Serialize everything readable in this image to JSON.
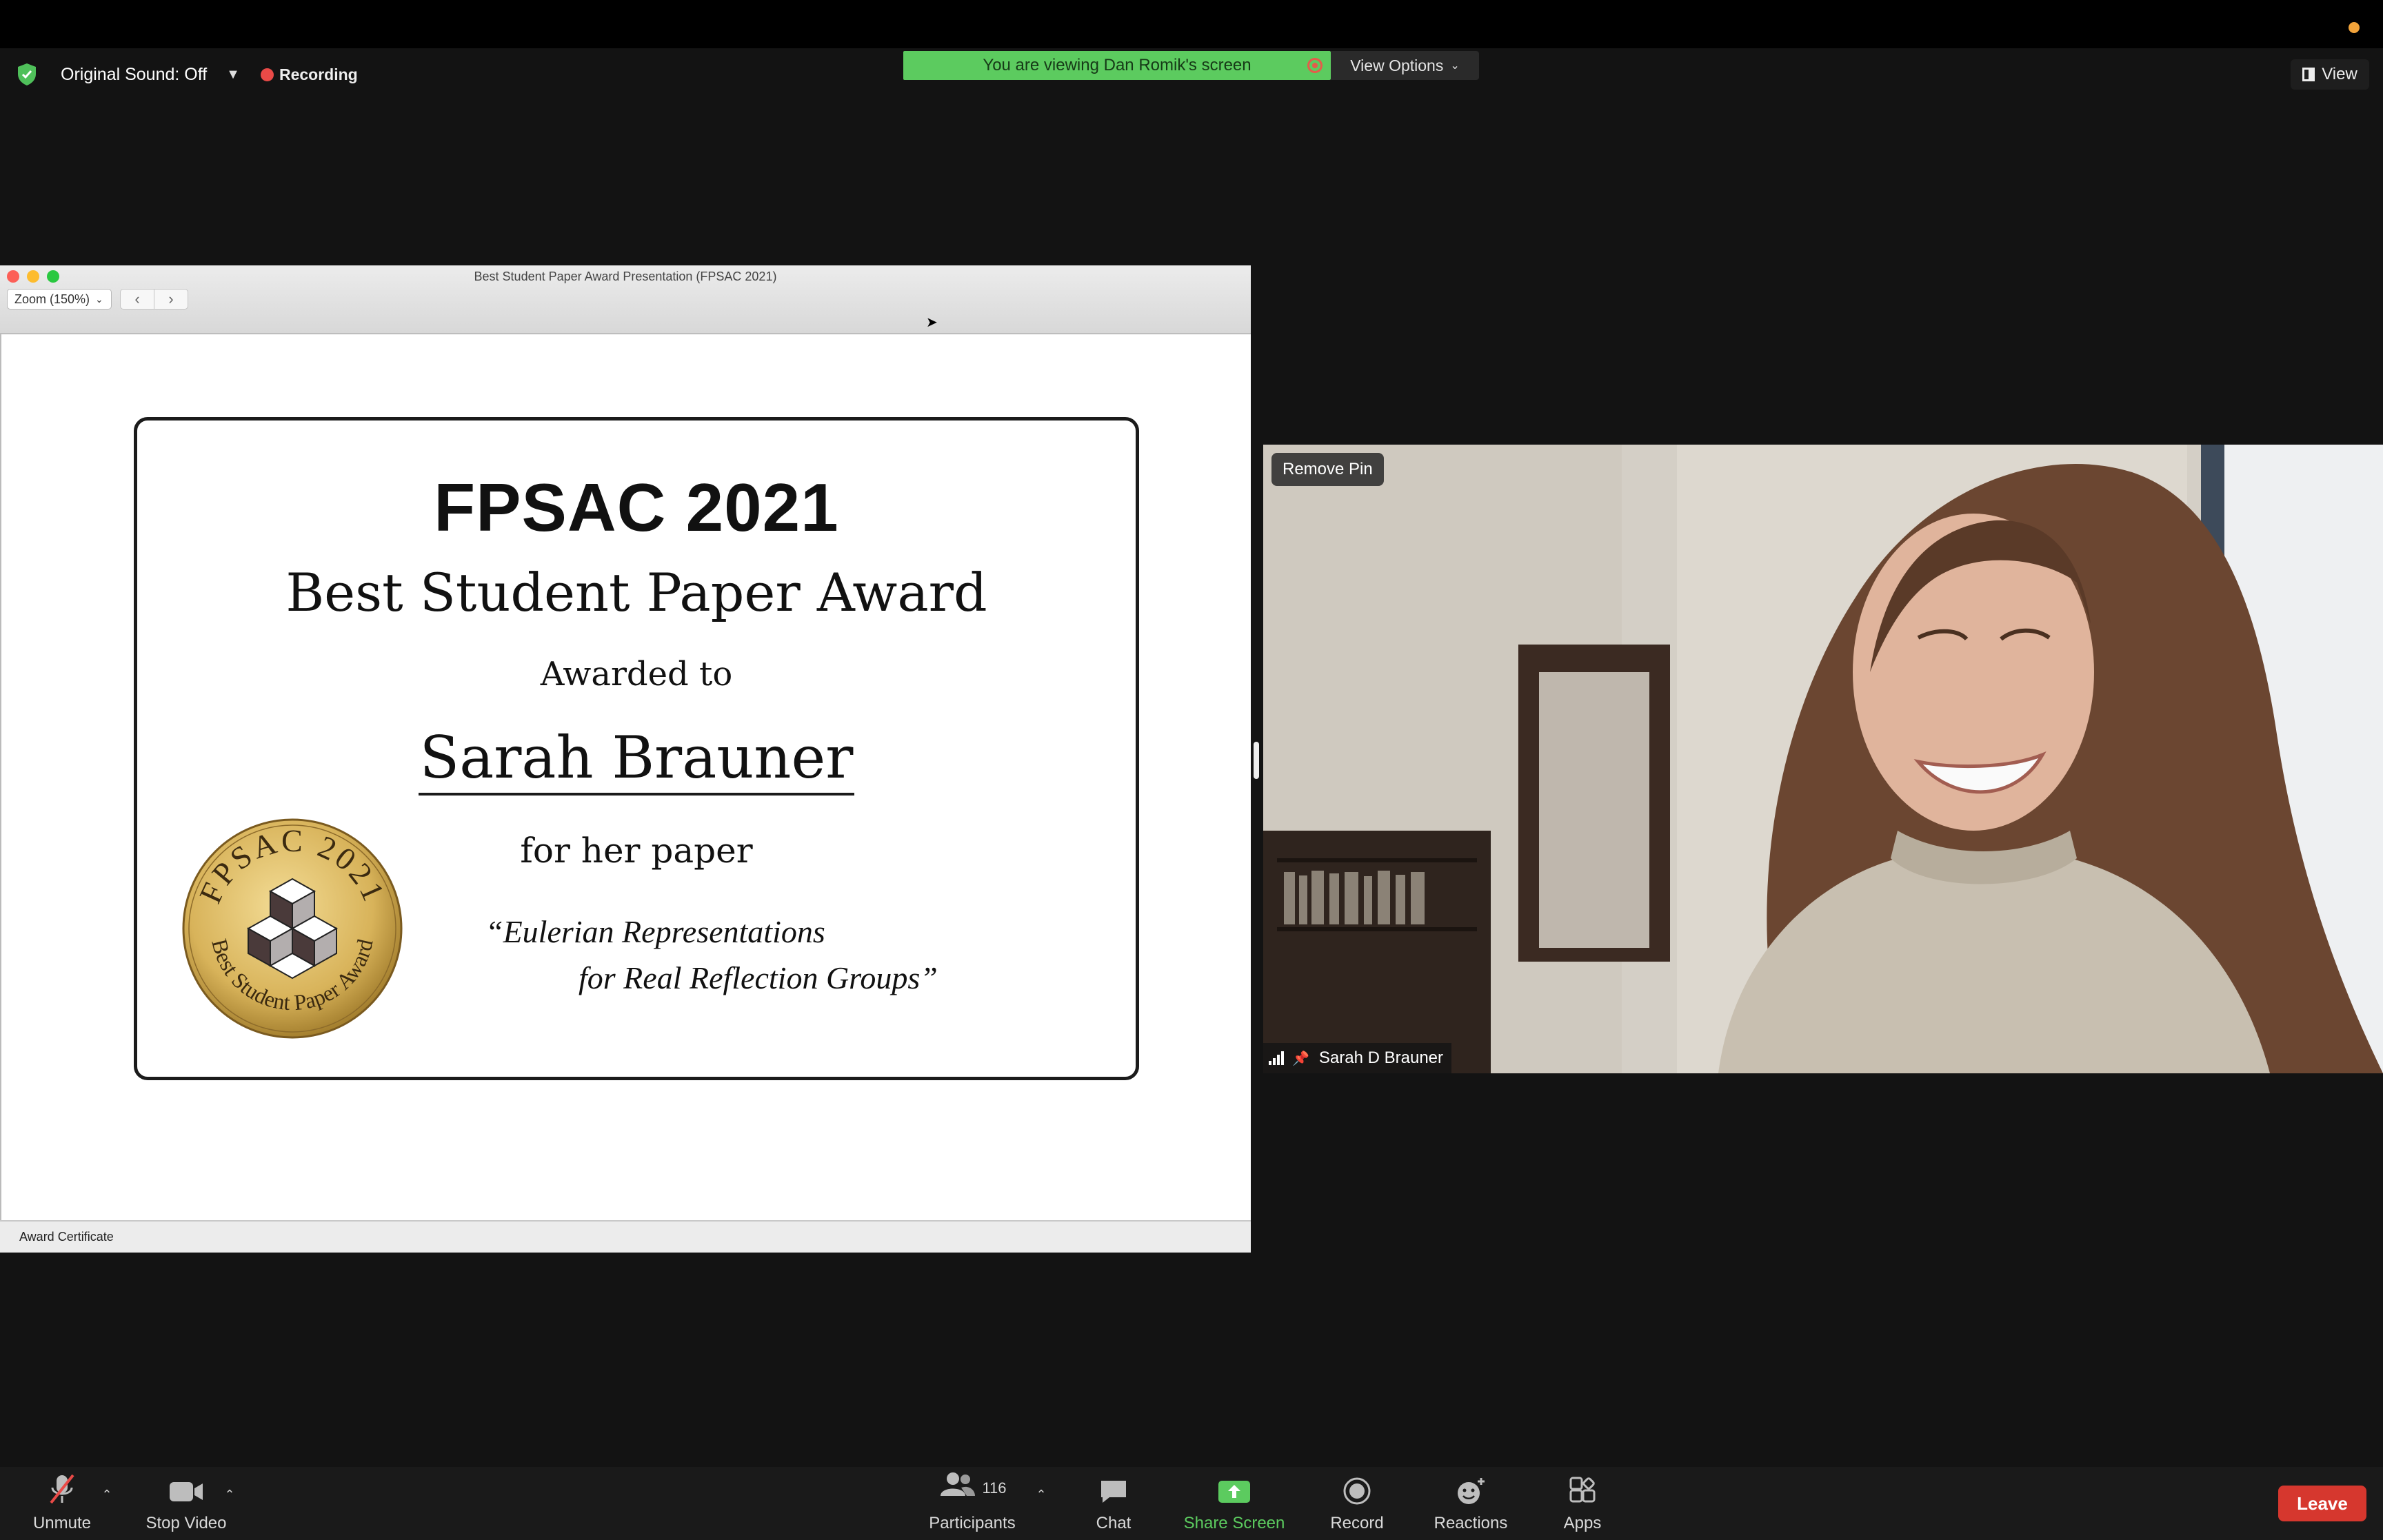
{
  "meeting": {
    "original_sound": "Original Sound: Off",
    "recording": "Recording",
    "share_banner": "You are viewing Dan Romik's screen",
    "view_options": "View Options",
    "view": "View"
  },
  "shared_window": {
    "title": "Best Student Paper Award Presentation (FPSAC 2021)",
    "zoom": "Zoom (150%)",
    "status": "Award Certificate"
  },
  "certificate": {
    "heading": "FPSAC 2021",
    "award": "Best Student Paper Award",
    "awarded_to": "Awarded to",
    "recipient": "Sarah Brauner",
    "for_paper": "for her paper",
    "paper_title_line1": "“Eulerian Representations",
    "paper_title_line2": "for Real Reflection Groups”",
    "seal_top": "FPSAC 2021",
    "seal_bottom": "Best Student Paper Award"
  },
  "video": {
    "remove_pin": "Remove Pin",
    "participant_name": "Sarah D Brauner"
  },
  "toolbar": {
    "unmute": "Unmute",
    "stop_video": "Stop Video",
    "participants_count": "116",
    "participants": "Participants",
    "chat": "Chat",
    "share_screen": "Share Screen",
    "record": "Record",
    "reactions": "Reactions",
    "apps": "Apps",
    "leave": "Leave"
  },
  "colors": {
    "share_green": "#5ccb5f",
    "leave_red": "#d6372e",
    "recording_red": "#e94a47",
    "seal_gold": "#d8b35a"
  }
}
